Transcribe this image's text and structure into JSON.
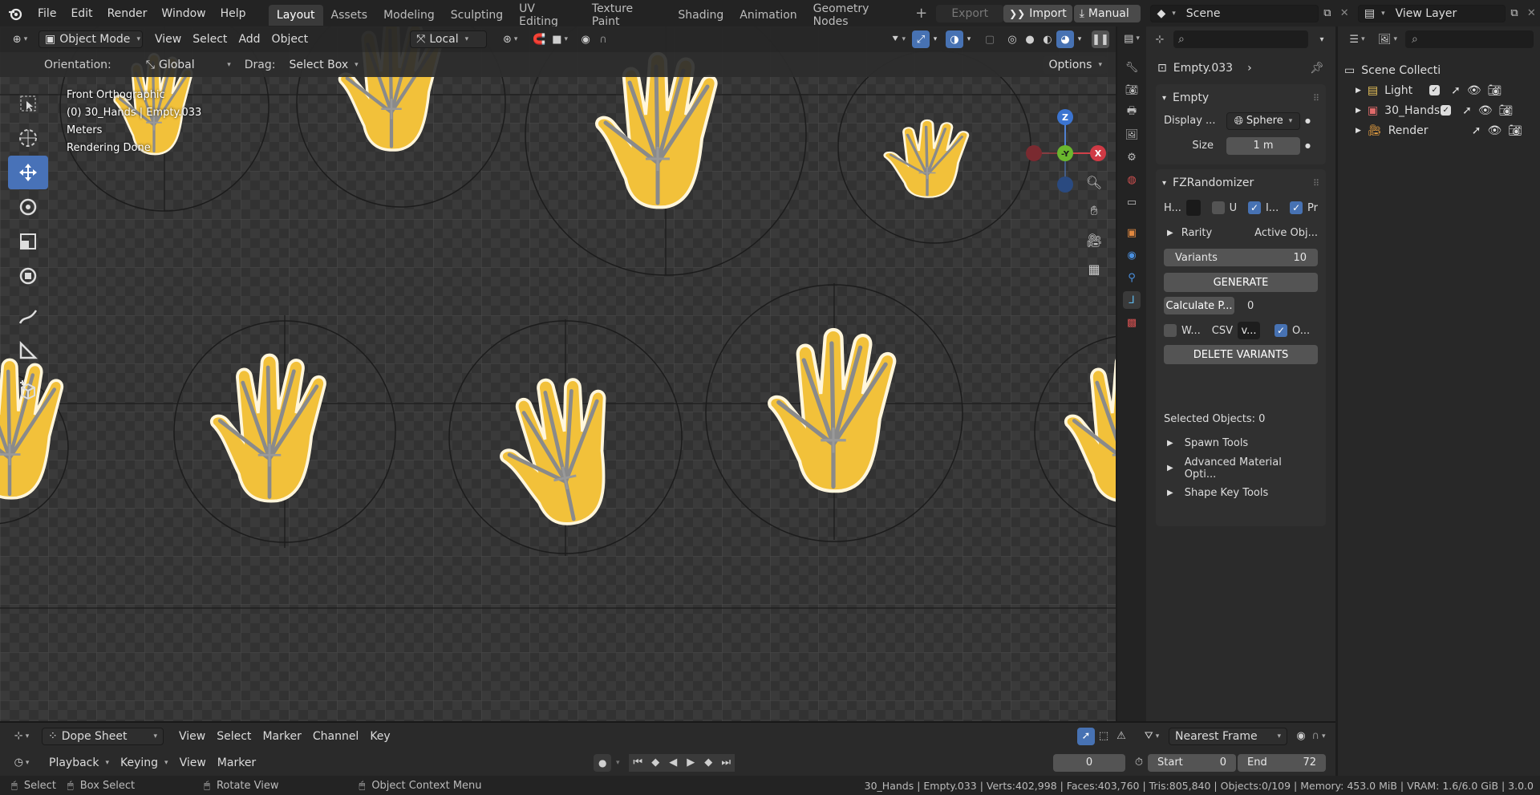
{
  "topbar": {
    "menus": [
      "File",
      "Edit",
      "Render",
      "Window",
      "Help"
    ],
    "workspaces": [
      "Layout",
      "Assets",
      "Modeling",
      "Sculpting",
      "UV Editing",
      "Texture Paint",
      "Shading",
      "Animation",
      "Geometry Nodes"
    ],
    "export_label": "Export",
    "import_label": "Import",
    "manual_label": "Manual",
    "scene_name": "Scene",
    "view_layer": "View Layer"
  },
  "viewport": {
    "mode": "Object Mode",
    "menus": [
      "View",
      "Select",
      "Add",
      "Object"
    ],
    "transform_space": "Local",
    "orientation_label": "Orientation:",
    "orientation_value": "Global",
    "drag_label": "Drag:",
    "drag_value": "Select Box",
    "options_label": "Options",
    "overlay_lines": [
      "Front Orthographic",
      "(0) 30_Hands | Empty.033",
      "Meters",
      "Rendering Done"
    ],
    "gizmo": {
      "z": "Z",
      "y": "-Y",
      "x": "X"
    }
  },
  "properties": {
    "object_name": "Empty.033",
    "empty_panel": {
      "title": "Empty",
      "display_label": "Display ...",
      "display_value": "Sphere",
      "size_label": "Size",
      "size_value": "1 m"
    },
    "fz_panel": {
      "title": "FZRandomizer",
      "h_label": "H...",
      "u_label": "U",
      "i_label": "I...",
      "pr_label": "Pr",
      "rarity_label": "Rarity",
      "rarity_value": "Active Obj...",
      "variants_label": "Variants",
      "variants_value": "10",
      "generate_label": "GENERATE",
      "calc_label": "Calculate P...",
      "calc_value": "0",
      "w_label": "W...",
      "csv_label": "CSV",
      "csv_value": "v...",
      "o_label": "O...",
      "delete_label": "DELETE VARIANTS",
      "selected_label": "Selected Objects: 0",
      "sections": [
        "Spawn Tools",
        "Advanced Material Opti...",
        "Shape Key Tools"
      ]
    }
  },
  "outliner": {
    "root": "Scene Collecti",
    "items": [
      {
        "name": "Light",
        "icon": "light-icon",
        "color": "#e8c25a"
      },
      {
        "name": "30_Hands",
        "icon": "collection-icon",
        "color": "#e06a6a"
      },
      {
        "name": "Render",
        "icon": "camera-icon",
        "color": "#e8a040"
      }
    ]
  },
  "dopesheet": {
    "editor": "Dope Sheet",
    "menus": [
      "View",
      "Select",
      "Marker",
      "Channel",
      "Key"
    ],
    "snap": "Nearest Frame"
  },
  "timeline": {
    "menus": [
      "Playback",
      "Keying",
      "View",
      "Marker"
    ],
    "current_frame": "0",
    "start_label": "Start",
    "start_value": "0",
    "end_label": "End",
    "end_value": "72"
  },
  "status": {
    "hints": [
      "Select",
      "Box Select",
      "Rotate View",
      "Object Context Menu"
    ],
    "stats": "30_Hands | Empty.033 | Verts:402,998 | Faces:403,760 | Tris:805,840 | Objects:0/109 | Memory: 453.0 MiB | VRAM: 1.6/6.0 GiB | 3.0.0"
  },
  "colors": {
    "accent": "#4772b3",
    "hand": "#f2c13a",
    "bone": "#8a8a8a"
  }
}
